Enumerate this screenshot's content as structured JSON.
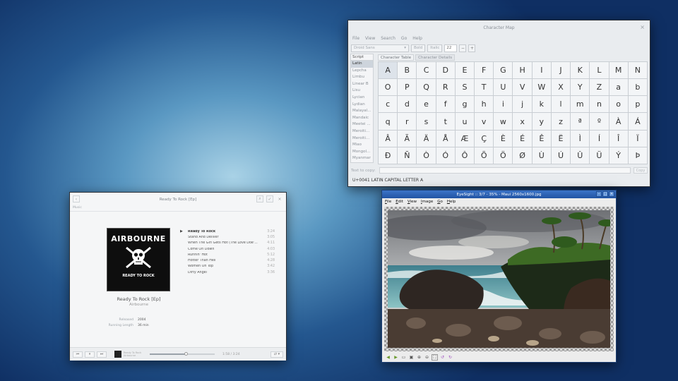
{
  "charmap": {
    "title": "Character Map",
    "menu": [
      "File",
      "View",
      "Search",
      "Go",
      "Help"
    ],
    "font": "Droid Sans",
    "bold_label": "Bold",
    "italic_label": "Italic",
    "size": "22",
    "minus": "−",
    "plus": "+",
    "scripts_header": "Script",
    "scripts": [
      "Latin",
      "Lepcha",
      "Limbu",
      "Linear B",
      "Lisu",
      "Lycian",
      "Lydian",
      "Malayal...",
      "Mandaic",
      "Meetei ...",
      "Meroiti...",
      "Meroiti...",
      "Miao",
      "Mongol...",
      "Myanmar"
    ],
    "selected_script": "Latin",
    "tabs": [
      "Character Table",
      "Character Details"
    ],
    "chars": [
      [
        "A",
        "B",
        "C",
        "D",
        "E",
        "F",
        "G",
        "H",
        "I",
        "J",
        "K",
        "L",
        "M",
        "N"
      ],
      [
        "O",
        "P",
        "Q",
        "R",
        "S",
        "T",
        "U",
        "V",
        "W",
        "X",
        "Y",
        "Z",
        "a",
        "b"
      ],
      [
        "c",
        "d",
        "e",
        "f",
        "g",
        "h",
        "i",
        "j",
        "k",
        "l",
        "m",
        "n",
        "o",
        "p"
      ],
      [
        "q",
        "r",
        "s",
        "t",
        "u",
        "v",
        "w",
        "x",
        "y",
        "z",
        "ª",
        "º",
        "À",
        "Á"
      ],
      [
        "Â",
        "Ã",
        "Ä",
        "Å",
        "Æ",
        "Ç",
        "È",
        "É",
        "Ê",
        "Ë",
        "Ì",
        "Í",
        "Î",
        "Ï"
      ],
      [
        "Ð",
        "Ñ",
        "Ò",
        "Ó",
        "Ô",
        "Õ",
        "Ö",
        "Ø",
        "Ù",
        "Ú",
        "Û",
        "Ü",
        "Ý",
        "Þ"
      ]
    ],
    "copy_label": "Text to copy:",
    "copy_value": "",
    "copy_button": "Copy",
    "status": "U+0041 LATIN CAPITAL LETTER A",
    "close_icon": "×"
  },
  "music": {
    "title": "Ready To Rock [Ep]",
    "breadcrumb": "Music",
    "cover_band": "AIRBOURNE",
    "cover_album": "READY TO ROCK",
    "album_title": "Ready To Rock [Ep]",
    "artist": "Airbourne",
    "released_label": "Released",
    "released_value": "2004",
    "length_label": "Running Length",
    "length_value": "36 min",
    "tracks": [
      {
        "name": "Ready To Rock",
        "duration": "3:24"
      },
      {
        "name": "Stand And Deliver",
        "duration": "3:05"
      },
      {
        "name": "When The Girl Gets Hot (The Love Doe'...",
        "duration": "4:11"
      },
      {
        "name": "Come On Down",
        "duration": "4:03"
      },
      {
        "name": "Runnin' Hot",
        "duration": "5:12"
      },
      {
        "name": "Hotter Than Hell",
        "duration": "4:28"
      },
      {
        "name": "Women On Top",
        "duration": "3:42"
      },
      {
        "name": "Dirty Angel",
        "duration": "3:36"
      }
    ],
    "progress_fraction": 0.56,
    "time_display": "1:58 / 3:24",
    "now_playing_line1": "Ready To Rock",
    "now_playing_line2": "Airbourne"
  },
  "eyesight": {
    "title": "EyeSight :: 3/7 - 35% - Maui 2560x1600.jpg",
    "menu": [
      "File",
      "Edit",
      "View",
      "Image",
      "Go",
      "Help"
    ]
  }
}
